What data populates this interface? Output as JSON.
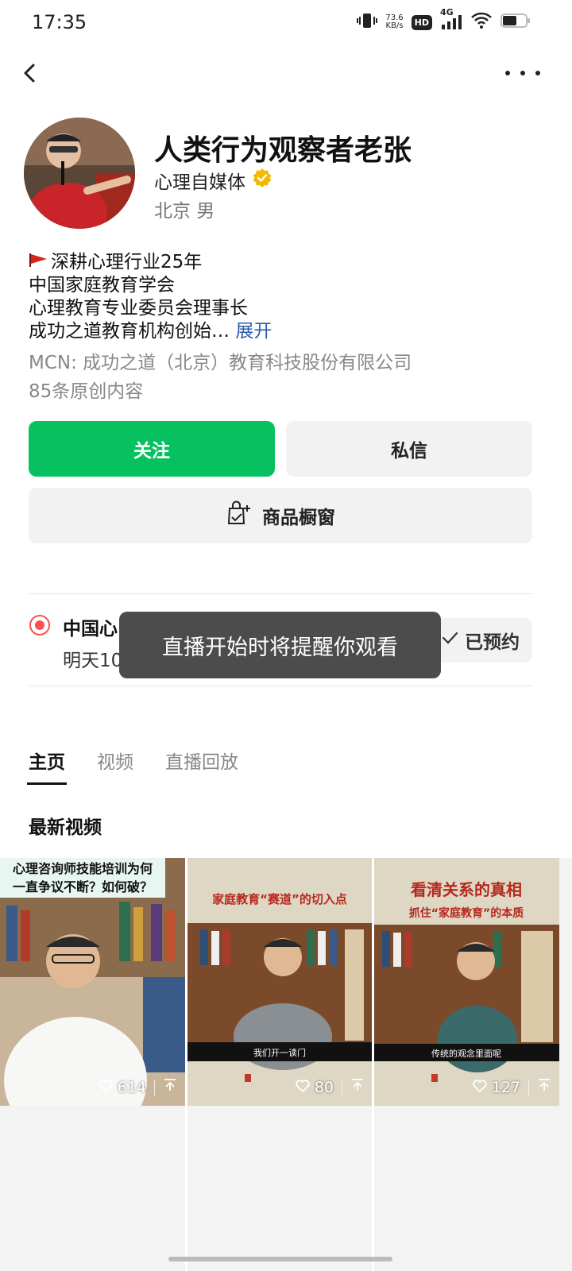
{
  "status_bar": {
    "time": "17:35",
    "net_speed_value": "73.6",
    "net_speed_unit": "KB/s",
    "hd_badge": "HD",
    "network": "4G",
    "battery_level": 0.55
  },
  "profile": {
    "name": "人类行为观察者老张",
    "category": "心理自媒体",
    "verified": true,
    "verified_color": "#f5b800",
    "location_gender": "北京 男",
    "bio_lines": [
      "深耕心理行业25年",
      "中国家庭教育学会",
      "心理教育专业委员会理事长",
      "成功之道教育机构创始…"
    ],
    "bio_expand": "展开",
    "mcn": "MCN: 成功之道（北京）教育科技股份有限公司",
    "original_count": "85条原创内容"
  },
  "actions": {
    "follow": "关注",
    "message": "私信",
    "shop": "商品橱窗",
    "accent_color": "#07c160"
  },
  "live": {
    "title": "中国心",
    "time": "明天10",
    "reserved_label": "已预约"
  },
  "toast": "直播开始时将提醒你观看",
  "tabs": [
    {
      "label": "主页",
      "active": true
    },
    {
      "label": "视频",
      "active": false
    },
    {
      "label": "直播回放",
      "active": false
    }
  ],
  "section_title": "最新视频",
  "videos": [
    {
      "caption_lines": [
        "心理咨询师技能培训为何",
        "一直争议不断？如何破？"
      ],
      "likes": "614"
    },
    {
      "caption_lines": [
        "家庭教育“赛道”的切入点"
      ],
      "subtitle": "我们开一读门",
      "likes": "80"
    },
    {
      "caption_lines": [
        "看清关系的真相",
        "抓住“家庭教育”的本质"
      ],
      "subtitle": "传统的观念里面呢",
      "likes": "127"
    }
  ]
}
